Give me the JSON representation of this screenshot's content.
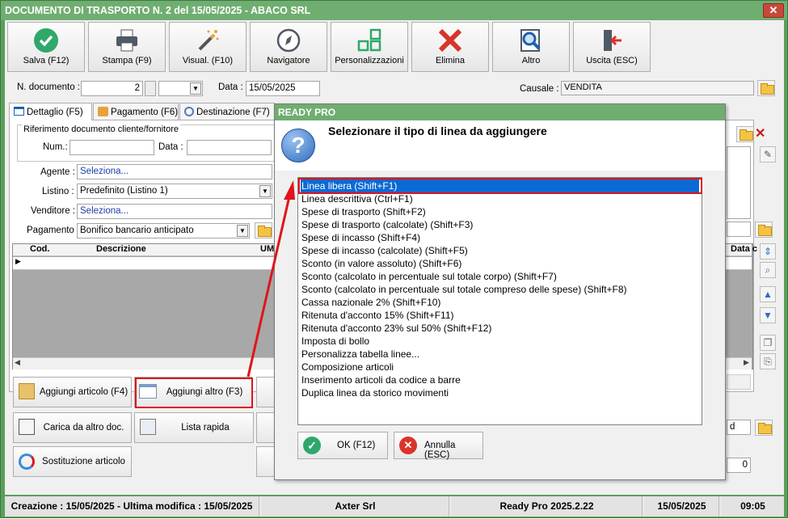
{
  "window": {
    "title": "DOCUMENTO DI TRASPORTO N. 2 del 15/05/2025 - ABACO SRL",
    "close": "✕"
  },
  "toolbar": [
    {
      "label": "Salva (F12)",
      "icon": "check-icon"
    },
    {
      "label": "Stampa (F9)",
      "icon": "printer-icon"
    },
    {
      "label": "Visual. (F10)",
      "icon": "magic-wand-icon"
    },
    {
      "label": "Navigatore",
      "icon": "compass-icon"
    },
    {
      "label": "Personalizzazioni",
      "icon": "grid-icon"
    },
    {
      "label": "Elimina",
      "icon": "delete-x-icon"
    },
    {
      "label": "Altro",
      "icon": "magnifier-icon"
    },
    {
      "label": "Uscita (ESC)",
      "icon": "exit-door-icon"
    }
  ],
  "header": {
    "ndoc_label": "N. documento :",
    "ndoc_value": "2",
    "data_label": "Data :",
    "data_value": "15/05/2025",
    "causale_label": "Causale :",
    "causale_value": "VENDITA"
  },
  "tabs": [
    {
      "label": "Dettaglio (F5)"
    },
    {
      "label": "Pagamento (F6)"
    },
    {
      "label": "Destinazione (F7)"
    }
  ],
  "form": {
    "rif_group": "Riferimento documento cliente/fornitore",
    "num_label": "Num.:",
    "data_label": "Data :",
    "agente_label": "Agente :",
    "agente_value": "Seleziona...",
    "listino_label": "Listino :",
    "listino_value": "Predefinito (Listino 1)",
    "venditore_label": "Venditore :",
    "venditore_value": "Seleziona...",
    "pagamento_label": "Pagamento :",
    "pagamento_value": "Bonifico bancario anticipato"
  },
  "grid": {
    "headers": [
      "Cod.",
      "Descrizione",
      "UM"
    ],
    "right_header": "Data c"
  },
  "bottom_buttons": [
    {
      "label": "Aggiungi articolo (F4)"
    },
    {
      "label": "Aggiungi altro (F3)"
    },
    {
      "label": "Carica da altro doc."
    },
    {
      "label": "Lista rapida"
    },
    {
      "label": "Sostituzione articolo"
    }
  ],
  "right_fields": {
    "field_d": "d",
    "field_zero": "0"
  },
  "dialog": {
    "title": "READY PRO",
    "heading": "Selezionare il tipo di linea da aggiungere",
    "items": [
      "Linea libera (Shift+F1)",
      "Linea descrittiva (Ctrl+F1)",
      "Spese di trasporto (Shift+F2)",
      "Spese di trasporto (calcolate) (Shift+F3)",
      "Spese di incasso (Shift+F4)",
      "Spese di incasso (calcolate) (Shift+F5)",
      "Sconto (in valore assoluto) (Shift+F6)",
      "Sconto (calcolato in percentuale sul totale corpo) (Shift+F7)",
      "Sconto (calcolato in percentuale sul totale compreso delle spese) (Shift+F8)",
      "Cassa nazionale 2% (Shift+F10)",
      "Ritenuta d'acconto 15% (Shift+F11)",
      "Ritenuta d'acconto 23% sul 50% (Shift+F12)",
      "Imposta di bollo",
      "Personalizza tabella linee...",
      "Composizione articoli",
      "Inserimento articoli da codice a barre",
      "Duplica linea da storico movimenti"
    ],
    "selected_index": 0,
    "ok_label": "OK (F12)",
    "cancel_label": "Annulla (ESC)"
  },
  "status": {
    "creazione": "Creazione : 15/05/2025 - Ultima modifica : 15/05/2025",
    "company": "Axter Srl",
    "version": "Ready Pro 2025.2.22",
    "date": "15/05/2025",
    "time": "09:05"
  },
  "colors": {
    "title_green": "#6fae70",
    "selection_blue": "#0b6ad3",
    "highlight_red": "#e0141a"
  }
}
